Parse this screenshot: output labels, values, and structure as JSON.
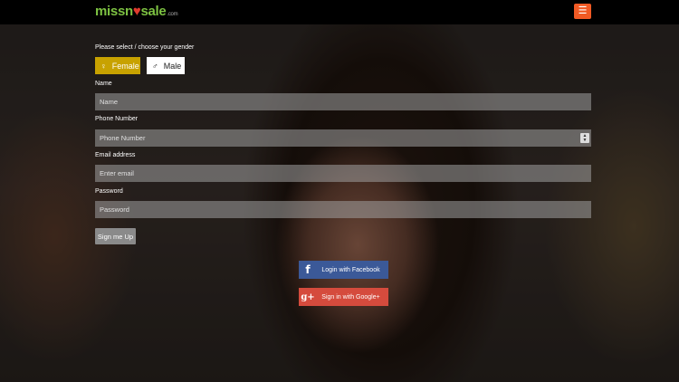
{
  "header": {
    "logo": {
      "part1": "missn",
      "heart": "♥",
      "part2": "sale",
      "suffix": ".com"
    },
    "menu_icon": "☰",
    "accent_color": "#f15a24"
  },
  "form": {
    "gender_prompt": "Please select / choose your gender",
    "gender_options": [
      {
        "label": "Female",
        "icon": "♀",
        "selected": true,
        "color": "#c8a200"
      },
      {
        "label": "Male",
        "icon": "♂",
        "selected": false,
        "color": "#ffffff"
      }
    ],
    "fields": {
      "name": {
        "label": "Name",
        "placeholder": "Name",
        "value": ""
      },
      "phone": {
        "label": "Phone Number",
        "placeholder": "Phone Number",
        "value": ""
      },
      "email": {
        "label": "Email address",
        "placeholder": "Enter email",
        "value": ""
      },
      "password": {
        "label": "Password",
        "placeholder": "Password",
        "value": ""
      }
    },
    "submit_label": "Sign me Up"
  },
  "social": {
    "facebook": {
      "label": "Login with Facebook",
      "icon": "f",
      "color": "#3b5998"
    },
    "google": {
      "label": "Sign in with Google+",
      "icon": "g+",
      "color": "#d54b3d"
    }
  }
}
